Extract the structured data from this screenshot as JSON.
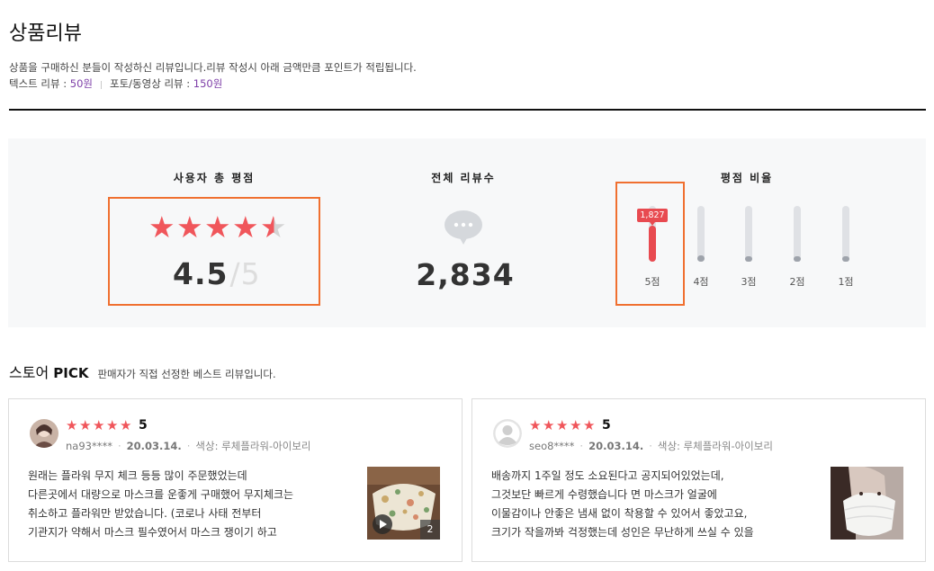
{
  "header": {
    "title": "상품리뷰",
    "description": "상품을 구매하신 분들이 작성하신 리뷰입니다.리뷰 작성시 아래 금액만큼 포인트가 적립됩니다.",
    "text_review_label": "텍스트 리뷰 : ",
    "text_review_points": "50원",
    "separator": "|",
    "photo_review_label": "포토/동영상 리뷰 : ",
    "photo_review_points": "150원"
  },
  "summary": {
    "score_title": "사용자 총 평점",
    "score": "4.5",
    "score_max": "/5",
    "score_fraction": 0.9,
    "total_title": "전체 리뷰수",
    "total": "2,834",
    "ratio_title": "평점 비율",
    "ratio_bars": [
      {
        "label": "5점",
        "count": "1,827",
        "fraction": 0.64,
        "active": true
      },
      {
        "label": "4점",
        "fraction": 0.12,
        "active": false
      },
      {
        "label": "3점",
        "fraction": 0.1,
        "active": false
      },
      {
        "label": "2점",
        "fraction": 0.1,
        "active": false
      },
      {
        "label": "1점",
        "fraction": 0.1,
        "active": false
      }
    ],
    "accent_color": "#e84a50",
    "highlight_border_color": "#f07030"
  },
  "pick": {
    "title_a": "스토어 ",
    "title_b": "PICK",
    "subtitle": "판매자가 직접 선정한 베스트 리뷰입니다."
  },
  "reviews": [
    {
      "rating": "5",
      "user": "na93****",
      "date": "20.03.14.",
      "option": "색상: 루체플라워-아이보리",
      "lines": [
        "원래는 플라워 무지 체크 등등 많이 주문했었는데",
        "다른곳에서 대량으로 마스크를 운좋게 구매했어 무지체크는",
        "취소하고 플라워만 받았습니다. (코로나 사태 전부터",
        "기관지가 약해서 마스크 필수였어서 마스크 쟁이기 하고"
      ],
      "media_count": "2"
    },
    {
      "rating": "5",
      "user": "seo8****",
      "date": "20.03.14.",
      "option": "색상: 루체플라워-아이보리",
      "lines": [
        "배송까지 1주일 정도 소요된다고 공지되어있었는데,",
        "그것보단 빠르게 수령했습니다 면 마스크가 얼굴에",
        "이물감이나 안좋은 냄새 없이 착용할 수 있어서 좋았고요,",
        "크기가 작을까봐 걱정했는데 성인은 무난하게 쓰실 수 있을"
      ]
    }
  ]
}
